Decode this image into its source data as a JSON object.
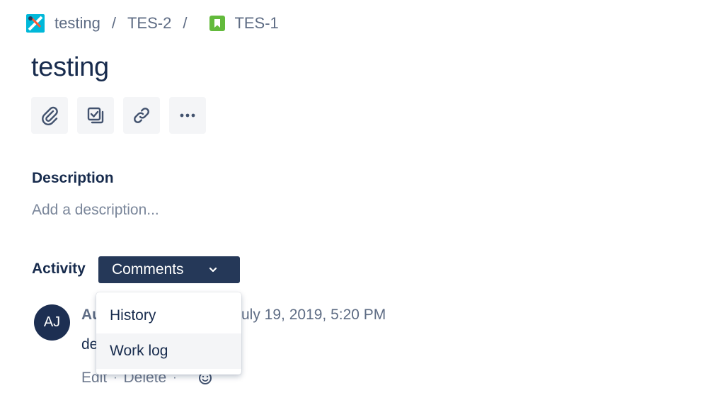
{
  "breadcrumb": {
    "project": "testing",
    "separator": "/",
    "parent": "TES-2",
    "issue": "TES-1"
  },
  "issue": {
    "title": "testing"
  },
  "toolbar": {
    "icons": [
      "attachment-icon",
      "subtask-icon",
      "link-icon",
      "more-icon"
    ]
  },
  "description": {
    "heading": "Description",
    "placeholder": "Add a description..."
  },
  "activity": {
    "label": "Activity",
    "selected": "Comments",
    "options": [
      "History",
      "Work log"
    ]
  },
  "comment": {
    "avatar_initials": "AJ",
    "author_visible": "Au",
    "date_visible": "uly 19, 2019, 5:20 PM",
    "body_visible": "de",
    "edit_label": "Edit",
    "delete_label": "Delete",
    "dot": "·"
  },
  "colors": {
    "text_primary": "#172b4d",
    "text_secondary": "#5e6c84",
    "dropdown_button": "#253858",
    "story_green": "#63ba3c",
    "toolbar_bg": "#f4f5f7"
  }
}
